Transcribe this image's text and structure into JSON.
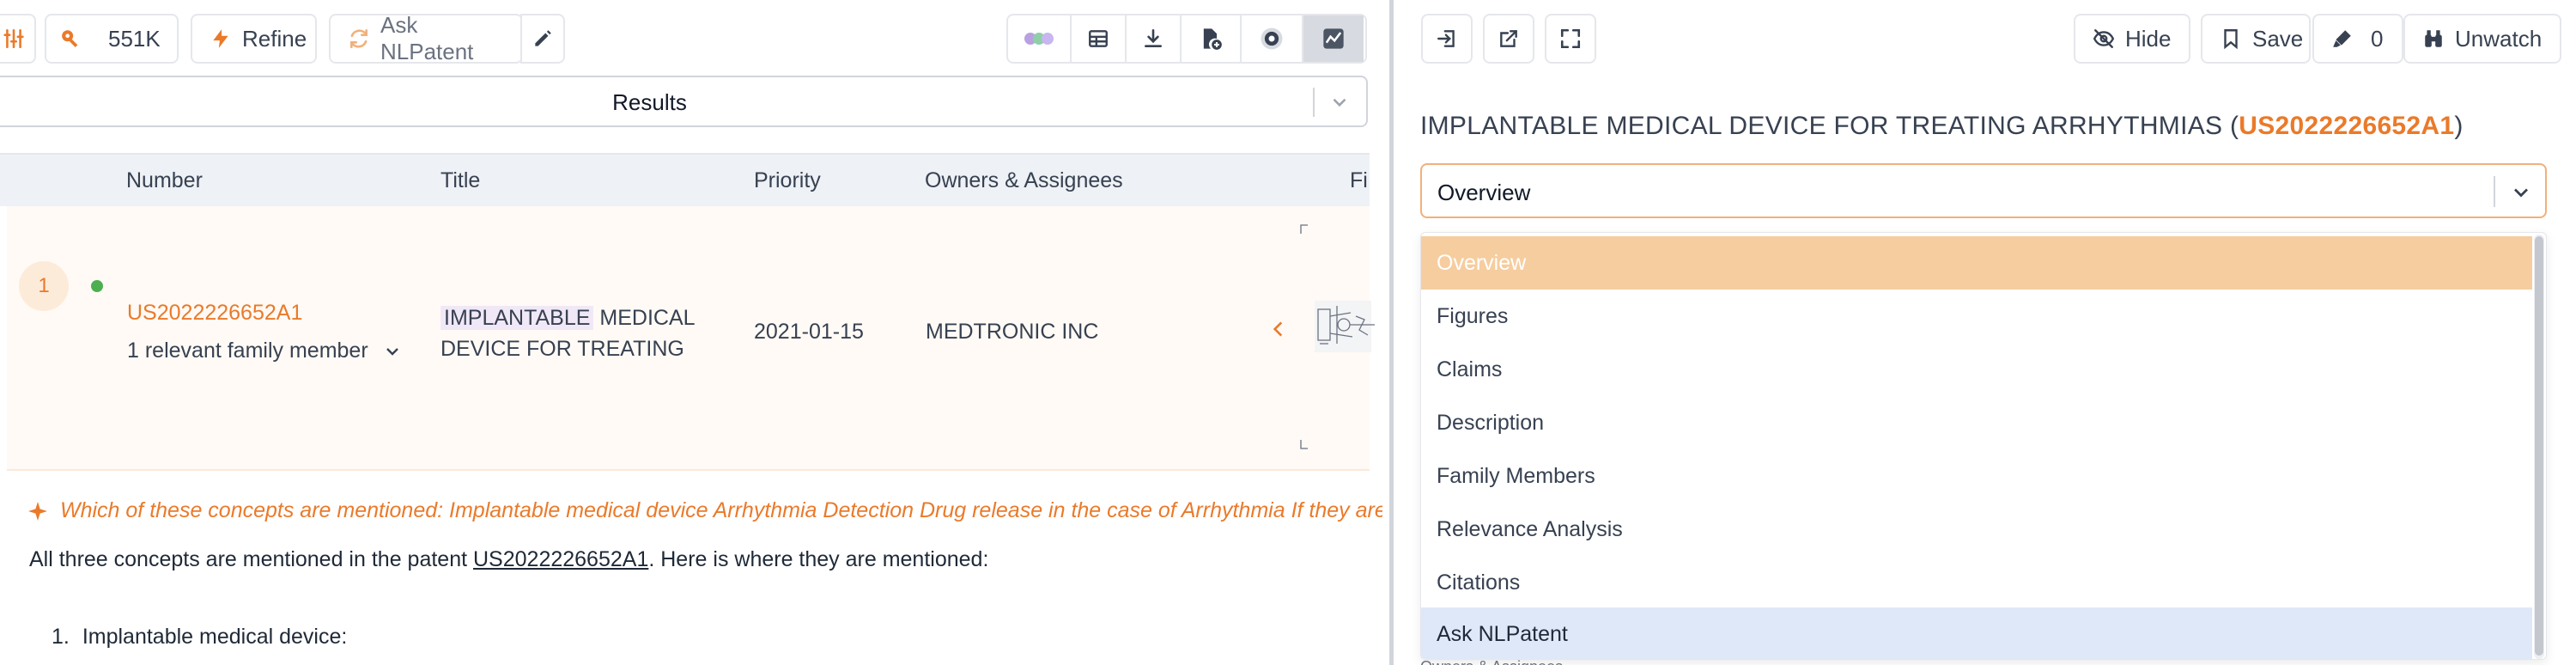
{
  "left": {
    "toolbar": {
      "count": "551K",
      "refine_label": "Refine",
      "ask_label": "Ask NLPatent"
    },
    "results_label": "Results",
    "table": {
      "headers": [
        "Number",
        "Title",
        "Priority",
        "Owners & Assignees",
        "Fi"
      ],
      "rows": [
        {
          "rank": "1",
          "number": "US2022226652A1",
          "family": "1 relevant family member",
          "title_highlight": "IMPLANTABLE",
          "title_rest": " MEDICAL DEVICE FOR TREATING",
          "priority": "2021-01-15",
          "owner": "MEDTRONIC INC"
        }
      ]
    },
    "ai": {
      "question": "Which of these concepts are mentioned: Implantable medical device Arrhythmia Detection Drug release in the case of Arrhythmia If they are mentioned, where are they mentioned?",
      "answer_before": "All three concepts are mentioned in the patent ",
      "answer_link": "US2022226652A1",
      "answer_after": ". Here is where they are mentioned:",
      "list_item_1": "Implantable medical device:",
      "list_marker": "1."
    }
  },
  "right": {
    "toolbar": {
      "hide_label": "Hide",
      "save_label": "Save",
      "annotation_count": "0",
      "unwatch_label": "Unwatch"
    },
    "title_text": "IMPLANTABLE MEDICAL DEVICE FOR TREATING ARRHYTHMIAS (",
    "title_number": "US2022226652A1",
    "title_close": ")",
    "section_select": {
      "value": "Overview",
      "options": [
        "Overview",
        "Figures",
        "Claims",
        "Description",
        "Family Members",
        "Relevance Analysis",
        "Citations",
        "Ask NLPatent"
      ],
      "selected": "Overview",
      "hovered": "Ask NLPatent"
    },
    "peek_label": "Owners & Assignees"
  },
  "colors": {
    "accent": "#ea7a2a",
    "selected_option": "#f6cd9f",
    "hover_option": "#dfe8f8"
  }
}
